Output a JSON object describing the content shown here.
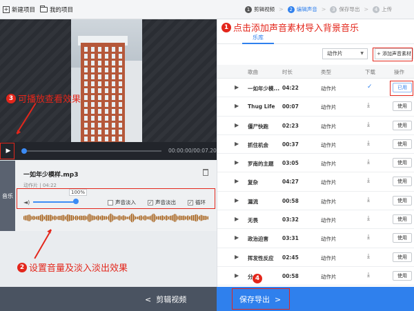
{
  "toolbar": {
    "new_project": "新建项目",
    "my_projects": "我的项目"
  },
  "steps": [
    {
      "num": "1",
      "label": "剪辑视频"
    },
    {
      "num": "2",
      "label": "编辑声音"
    },
    {
      "num": "3",
      "label": "保存导出"
    },
    {
      "num": "4",
      "label": "上传"
    }
  ],
  "player": {
    "timecode": "00:00:00/00:07.20",
    "progress": 0.0
  },
  "audio": {
    "tab": "音乐",
    "name": "一如年少模样.mp3",
    "category": "动作片",
    "duration": "04:22",
    "volume_label": "100%",
    "volume": 1.0,
    "fade_in": {
      "label": "声音淡入",
      "checked": false
    },
    "fade_out": {
      "label": "声音淡出",
      "checked": true
    },
    "loop": {
      "label": "循环",
      "checked": true
    }
  },
  "library": {
    "tab": "乐库",
    "filter": "动作片",
    "add_button": "+ 添加声音素材",
    "headers": {
      "song": "歌曲",
      "duration": "时长",
      "type": "类型",
      "download": "下载",
      "action": "操作"
    },
    "rows": [
      {
        "name": "一如年少模...",
        "duration": "04:22",
        "type": "动作片",
        "downloaded": true,
        "action": "已用"
      },
      {
        "name": "Thug Life",
        "duration": "00:07",
        "type": "动作片",
        "downloaded": false,
        "action": "使用"
      },
      {
        "name": "僵尸快跑",
        "duration": "02:23",
        "type": "动作片",
        "downloaded": false,
        "action": "使用"
      },
      {
        "name": "抓住机会",
        "duration": "00:37",
        "type": "动作片",
        "downloaded": false,
        "action": "使用"
      },
      {
        "name": "罗南的主题",
        "duration": "03:05",
        "type": "动作片",
        "downloaded": false,
        "action": "使用"
      },
      {
        "name": "复杂",
        "duration": "04:27",
        "type": "动作片",
        "downloaded": false,
        "action": "使用"
      },
      {
        "name": "漏流",
        "duration": "00:58",
        "type": "动作片",
        "downloaded": false,
        "action": "使用"
      },
      {
        "name": "无畏",
        "duration": "03:32",
        "type": "动作片",
        "downloaded": false,
        "action": "使用"
      },
      {
        "name": "政治迫害",
        "duration": "03:31",
        "type": "动作片",
        "downloaded": false,
        "action": "使用"
      },
      {
        "name": "挥发性反应",
        "duration": "02:45",
        "type": "动作片",
        "downloaded": false,
        "action": "使用"
      },
      {
        "name": "分...",
        "duration": "00:58",
        "type": "动作片",
        "downloaded": false,
        "action": "使用"
      }
    ]
  },
  "footer": {
    "back": "剪辑视频",
    "next": "保存导出"
  },
  "annotations": {
    "a1": {
      "num": "1",
      "text": "点击添加声音素材导入背景音乐"
    },
    "a2": {
      "num": "2",
      "text": "设置音量及淡入淡出效果"
    },
    "a3": {
      "num": "3",
      "text": "可播放查看效果"
    },
    "a4": {
      "num": "4",
      "text": ""
    }
  },
  "colors": {
    "accent": "#2f80ed",
    "annotation": "#e3261b",
    "footer_left": "#4a5361"
  }
}
